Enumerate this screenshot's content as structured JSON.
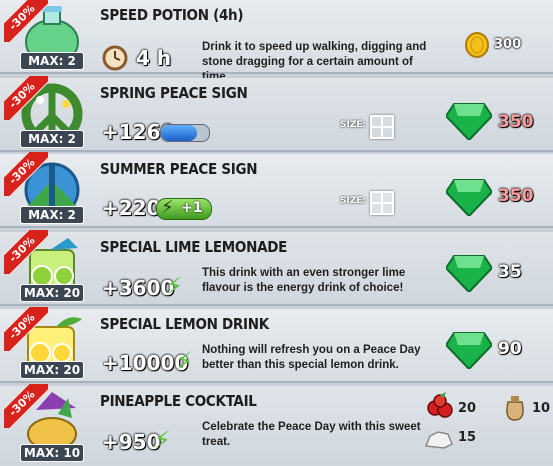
{
  "items": [
    {
      "discount": "-30%",
      "max": "MAX: 2",
      "title": "SPEED POTION (4h)",
      "amount": "4 h",
      "desc": "Drink it to speed up walking, digging and stone dragging for a certain amount of time.",
      "price": "300",
      "currency": "coin-icon"
    },
    {
      "discount": "-30%",
      "max": "MAX: 2",
      "title": "SPRING PEACE SIGN",
      "amount": "+1260",
      "size_label": "SIZE:",
      "price": "350",
      "currency": "emerald-icon"
    },
    {
      "discount": "-30%",
      "max": "MAX: 2",
      "title": "SUMMER PEACE SIGN",
      "amount": "+220",
      "bonus": "+1",
      "size_label": "SIZE:",
      "price": "350",
      "currency": "emerald-icon"
    },
    {
      "discount": "-30%",
      "max": "MAX: 20",
      "title": "SPECIAL LIME LEMONADE",
      "amount": "+3600",
      "desc": "This drink with an even stronger lime flavour is the energy drink of choice!",
      "price": "35",
      "currency": "emerald-icon"
    },
    {
      "discount": "-30%",
      "max": "MAX: 20",
      "title": "SPECIAL LEMON DRINK",
      "amount": "+10000",
      "desc": "Nothing will refresh you on a Peace Day better than this special lemon drink.",
      "price": "90",
      "currency": "emerald-icon"
    },
    {
      "discount": "-30%",
      "max": "MAX: 10",
      "title": "PINEAPPLE COCKTAIL",
      "amount": "+950",
      "desc": "Celebrate the Peace Day with this sweet treat.",
      "cost_berries": "20",
      "cost_sack": "10",
      "cost_stone": "15"
    }
  ],
  "colors": {
    "ribbon": "#d8221c",
    "emerald": "#19b34a",
    "coin": "#f2c21a",
    "energy": "#5ec33a",
    "price_red": "#ff9d9d"
  }
}
